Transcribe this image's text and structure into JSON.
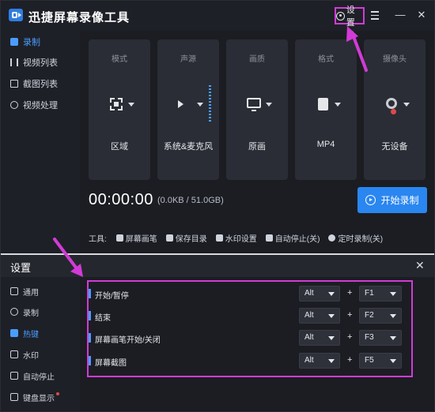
{
  "app": {
    "title": "迅捷屏幕录像工具",
    "settings_label": "设置"
  },
  "sidebar": {
    "items": [
      {
        "label": "录制",
        "icon": "record-icon",
        "active": true
      },
      {
        "label": "视频列表",
        "icon": "video-list-icon",
        "active": false
      },
      {
        "label": "截图列表",
        "icon": "screenshot-list-icon",
        "active": false
      },
      {
        "label": "视频处理",
        "icon": "video-process-icon",
        "active": false
      }
    ]
  },
  "cards": [
    {
      "label": "模式",
      "value": "区域",
      "icon": "region-icon"
    },
    {
      "label": "声源",
      "value": "系统&麦克风",
      "icon": "speaker-icon"
    },
    {
      "label": "画质",
      "value": "原画",
      "icon": "monitor-icon"
    },
    {
      "label": "格式",
      "value": "MP4",
      "icon": "file-icon"
    },
    {
      "label": "摄像头",
      "value": "无设备",
      "icon": "camera-icon"
    }
  ],
  "recording": {
    "timer": "00:00:00",
    "size": "(0.0KB / 51.0GB)",
    "start_label": "开始录制"
  },
  "tools": {
    "label": "工具:",
    "items": [
      "屏幕画笔",
      "保存目录",
      "水印设置",
      "自动停止(关)",
      "定时录制(关)"
    ]
  },
  "settings": {
    "title": "设置",
    "nav": [
      {
        "label": "通用",
        "active": false
      },
      {
        "label": "录制",
        "active": false
      },
      {
        "label": "热键",
        "active": true
      },
      {
        "label": "水印",
        "active": false
      },
      {
        "label": "自动停止",
        "active": false
      },
      {
        "label": "键盘显示",
        "active": false
      }
    ],
    "hotkeys": [
      {
        "label": "开始/暂停",
        "modifier": "Alt",
        "plus": "+",
        "key": "F1"
      },
      {
        "label": "结束",
        "modifier": "Alt",
        "plus": "+",
        "key": "F2"
      },
      {
        "label": "屏幕画笔开始/关闭",
        "modifier": "Alt",
        "plus": "+",
        "key": "F3"
      },
      {
        "label": "屏幕截图",
        "modifier": "Alt",
        "plus": "+",
        "key": "F5"
      }
    ]
  },
  "colors": {
    "accent": "#2a86f0",
    "annotation": "#d23bd6",
    "background": "#1b1d23"
  }
}
